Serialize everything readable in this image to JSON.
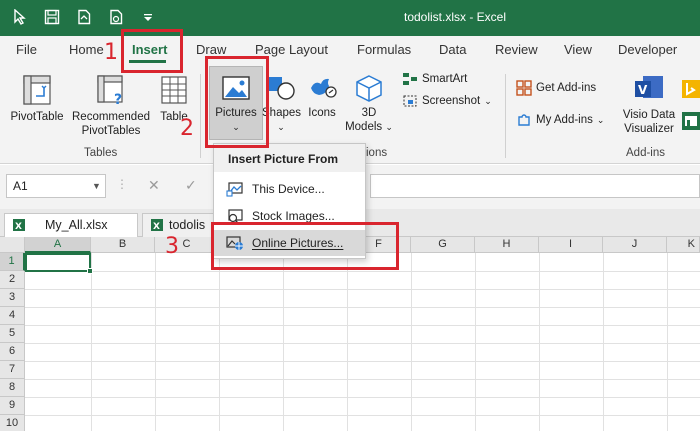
{
  "window": {
    "title": "todolist.xlsx  -  Excel"
  },
  "quick_access": [
    "touch-mode-icon",
    "save-icon",
    "save-as-icon",
    "print-preview-icon",
    "customize-qat-icon"
  ],
  "tabs": [
    {
      "label": "File"
    },
    {
      "label": "Home"
    },
    {
      "label": "Insert"
    },
    {
      "label": "Draw"
    },
    {
      "label": "Page Layout"
    },
    {
      "label": "Formulas"
    },
    {
      "label": "Data"
    },
    {
      "label": "Review"
    },
    {
      "label": "View"
    },
    {
      "label": "Developer"
    }
  ],
  "ribbon": {
    "tables": {
      "label": "Tables",
      "pivottable": "PivotTable",
      "recommended_line1": "Recommended",
      "recommended_line2": "PivotTables",
      "table": "Table"
    },
    "illustrations": {
      "pictures": "Pictures",
      "shapes": "Shapes",
      "icons": "Icons",
      "models_line1": "3D",
      "models_line2": "Models",
      "smartart": "SmartArt",
      "screenshot": "Screenshot",
      "group_partial": "ions"
    },
    "addins": {
      "label": "Add-ins",
      "get": "Get Add-ins",
      "my": "My Add-ins",
      "visio_line1": "Visio Data",
      "visio_line2": "Visualizer"
    }
  },
  "formula_bar": {
    "namebox": "A1",
    "cancel": "✕",
    "enter": "✓"
  },
  "sheet_tabs": [
    {
      "label": "My_All.xlsx"
    },
    {
      "label": "todolis"
    }
  ],
  "columns": [
    "A",
    "B",
    "C",
    "D",
    "E",
    "F",
    "G",
    "H",
    "I",
    "J",
    "K"
  ],
  "rows": [
    "1",
    "2",
    "3",
    "4",
    "5",
    "6",
    "7",
    "8",
    "9",
    "10"
  ],
  "dropdown": {
    "header": "Insert Picture From",
    "items": [
      {
        "label": "This Device..."
      },
      {
        "label": "Stock Images..."
      },
      {
        "label": "Online Pictures..."
      }
    ]
  },
  "annotations": [
    "1",
    "2",
    "3"
  ],
  "colors": {
    "excel_green": "#217346",
    "annotation_red": "#d9252e"
  }
}
